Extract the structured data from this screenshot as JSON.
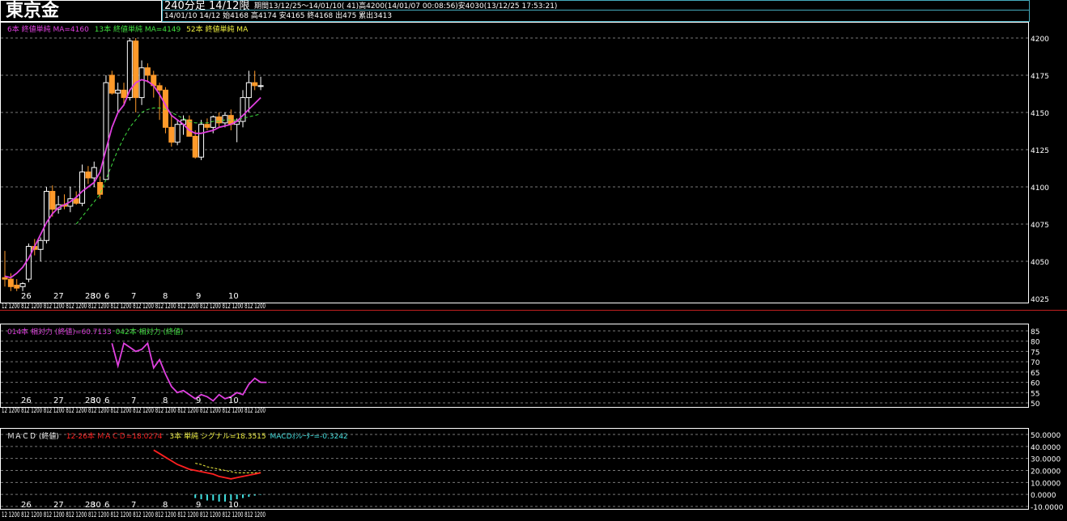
{
  "header": {
    "title": "東京金",
    "timeframe": "240分足 14/12限",
    "period": "期間13/12/25～14/01/10( 41)高4200(14/01/07 00:08:56)安4030(13/12/25 17:53:21)",
    "last_bar": "14/01/10 14/12 始4168 高4174 安4165 終4168 出475 累出3413"
  },
  "main_panel": {
    "legend": [
      {
        "text": "6本 終値単純 MA=4160",
        "color": "#e040e0"
      },
      {
        "text": "13本 終値単純 MA=4149",
        "color": "#40e040"
      },
      {
        "text": "52本 終値単純 MA",
        "color": "#f0f040"
      }
    ],
    "y_ticks": [
      "4200",
      "4175",
      "4150",
      "4125",
      "4100",
      "4075",
      "4050",
      "4025"
    ],
    "date_labels": [
      "26",
      "27",
      "28",
      "30",
      "6",
      "7",
      "8",
      "9",
      "10"
    ],
    "time_labels": "12 1200 812 1200 812 1200 812 1200 812 1200 812 1200 812 1200 812 1200 812 1200 812 1200 812 1200 812 1200"
  },
  "rsi_panel": {
    "legend": [
      {
        "text": "014本 相対力 (終値)=60.7133",
        "color": "#e040e0"
      },
      {
        "text": "042本 相対力 (終値)",
        "color": "#40e040"
      }
    ],
    "y_ticks": [
      "85",
      "80",
      "75",
      "70",
      "65",
      "60",
      "55",
      "50"
    ],
    "date_labels": [
      "26",
      "27",
      "28",
      "30",
      "6",
      "7",
      "8",
      "9",
      "10"
    ]
  },
  "macd_panel": {
    "legend": [
      {
        "text": "ＭＡＣＤ (終値)",
        "color": "#ffffff"
      },
      {
        "text": "12-26本 ＭＡＣＤ=18.0274",
        "color": "#ff2020"
      },
      {
        "text": "3本 単純 シグナル=18.3515",
        "color": "#f0f040"
      },
      {
        "text": "MACDｵｼﾚｰﾀｰ=-0.3242",
        "color": "#40e0e0"
      }
    ],
    "y_ticks": [
      "50.0000",
      "40.0000",
      "30.0000",
      "20.0000",
      "10.0000",
      "0.0000",
      "-10.0000"
    ],
    "date_labels": [
      "26",
      "27",
      "28",
      "30",
      "6",
      "7",
      "8",
      "9",
      "10"
    ]
  },
  "chart_data": [
    {
      "type": "candlestick",
      "title": "東京金",
      "ylim": [
        4025,
        4200
      ],
      "candles": [
        {
          "o": 4039,
          "h": 4057,
          "l": 4033,
          "c": 4038
        },
        {
          "o": 4038,
          "h": 4042,
          "l": 4030,
          "c": 4033
        },
        {
          "o": 4034,
          "h": 4038,
          "l": 4030,
          "c": 4032
        },
        {
          "o": 4033,
          "h": 4036,
          "l": 4030,
          "c": 4035
        },
        {
          "o": 4038,
          "h": 4062,
          "l": 4036,
          "c": 4060
        },
        {
          "o": 4060,
          "h": 4065,
          "l": 4054,
          "c": 4058
        },
        {
          "o": 4058,
          "h": 4066,
          "l": 4050,
          "c": 4064
        },
        {
          "o": 4064,
          "h": 4100,
          "l": 4062,
          "c": 4097
        },
        {
          "o": 4097,
          "h": 4101,
          "l": 4080,
          "c": 4085
        },
        {
          "o": 4085,
          "h": 4094,
          "l": 4082,
          "c": 4088
        },
        {
          "o": 4088,
          "h": 4095,
          "l": 4085,
          "c": 4087
        },
        {
          "o": 4087,
          "h": 4100,
          "l": 4083,
          "c": 4092
        },
        {
          "o": 4092,
          "h": 4097,
          "l": 4088,
          "c": 4089
        },
        {
          "o": 4089,
          "h": 4115,
          "l": 4087,
          "c": 4110
        },
        {
          "o": 4110,
          "h": 4114,
          "l": 4102,
          "c": 4106
        },
        {
          "o": 4106,
          "h": 4117,
          "l": 4100,
          "c": 4113
        },
        {
          "o": 4103,
          "h": 4107,
          "l": 4092,
          "c": 4095
        },
        {
          "o": 4105,
          "h": 4175,
          "l": 4150,
          "c": 4170
        },
        {
          "o": 4175,
          "h": 4178,
          "l": 4162,
          "c": 4163
        },
        {
          "o": 4163,
          "h": 4170,
          "l": 4150,
          "c": 4165
        },
        {
          "o": 4165,
          "h": 4170,
          "l": 4155,
          "c": 4160
        },
        {
          "o": 4160,
          "h": 4200,
          "l": 4158,
          "c": 4198
        },
        {
          "o": 4198,
          "h": 4200,
          "l": 4150,
          "c": 4160
        },
        {
          "o": 4160,
          "h": 4185,
          "l": 4155,
          "c": 4180
        },
        {
          "o": 4180,
          "h": 4183,
          "l": 4170,
          "c": 4175
        },
        {
          "o": 4175,
          "h": 4178,
          "l": 4160,
          "c": 4168
        },
        {
          "o": 4168,
          "h": 4170,
          "l": 4145,
          "c": 4165
        },
        {
          "o": 4165,
          "h": 4167,
          "l": 4136,
          "c": 4140
        },
        {
          "o": 4140,
          "h": 4148,
          "l": 4127,
          "c": 4130
        },
        {
          "o": 4130,
          "h": 4145,
          "l": 4128,
          "c": 4142
        },
        {
          "o": 4142,
          "h": 4148,
          "l": 4135,
          "c": 4145
        },
        {
          "o": 4145,
          "h": 4148,
          "l": 4138,
          "c": 4134
        },
        {
          "o": 4134,
          "h": 4138,
          "l": 4119,
          "c": 4120
        },
        {
          "o": 4120,
          "h": 4145,
          "l": 4118,
          "c": 4142
        },
        {
          "o": 4142,
          "h": 4146,
          "l": 4138,
          "c": 4140
        },
        {
          "o": 4140,
          "h": 4148,
          "l": 4136,
          "c": 4147
        },
        {
          "o": 4147,
          "h": 4150,
          "l": 4140,
          "c": 4143
        },
        {
          "o": 4143,
          "h": 4150,
          "l": 4140,
          "c": 4148
        },
        {
          "o": 4148,
          "h": 4152,
          "l": 4138,
          "c": 4142
        },
        {
          "o": 4142,
          "h": 4146,
          "l": 4130,
          "c": 4144
        },
        {
          "o": 4144,
          "h": 4165,
          "l": 4140,
          "c": 4160
        },
        {
          "o": 4160,
          "h": 4178,
          "l": 4150,
          "c": 4170
        },
        {
          "o": 4170,
          "h": 4178,
          "l": 4165,
          "c": 4168
        },
        {
          "o": 4168,
          "h": 4174,
          "l": 4165,
          "c": 4168
        }
      ],
      "ma6": [
        4040,
        4039,
        4042,
        4046,
        4052,
        4060,
        4068,
        4076,
        4082,
        4086,
        4088,
        4090,
        4093,
        4097,
        4100,
        4103,
        4110,
        4125,
        4140,
        4150,
        4155,
        4165,
        4170,
        4172,
        4171,
        4168,
        4162,
        4155,
        4148,
        4145,
        4142,
        4138,
        4136,
        4136,
        4137,
        4138,
        4140,
        4141,
        4142,
        4144,
        4148,
        4152,
        4156,
        4160
      ],
      "ma13": [
        null,
        null,
        null,
        null,
        null,
        null,
        null,
        null,
        null,
        null,
        null,
        null,
        4075,
        4080,
        4085,
        4090,
        4095,
        4105,
        4115,
        4125,
        4133,
        4140,
        4145,
        4150,
        4152,
        4153,
        4153,
        4152,
        4150,
        4148,
        4146,
        4144,
        4143,
        4143,
        4143,
        4144,
        4144,
        4145,
        4145,
        4145,
        4146,
        4147,
        4148,
        4149
      ]
    },
    {
      "type": "line",
      "title": "014本 相対力 (終値)",
      "ylim": [
        50,
        85
      ],
      "values": [
        null,
        null,
        null,
        null,
        null,
        null,
        null,
        null,
        null,
        null,
        null,
        null,
        null,
        null,
        null,
        null,
        null,
        null,
        79,
        68,
        79,
        77,
        75,
        76,
        79,
        67,
        71,
        64,
        58,
        55,
        56,
        54,
        52,
        54,
        53,
        51,
        54,
        52,
        53,
        55,
        54,
        59,
        62,
        60,
        60
      ]
    },
    {
      "type": "line",
      "title": "ＭＡＣＤ (終値)",
      "ylim": [
        -10,
        50
      ],
      "macd": [
        null,
        null,
        null,
        null,
        null,
        null,
        null,
        null,
        null,
        null,
        null,
        null,
        null,
        null,
        null,
        null,
        null,
        null,
        null,
        null,
        null,
        null,
        null,
        null,
        null,
        37,
        34,
        31,
        28,
        25,
        23,
        21,
        20,
        19,
        18,
        17,
        15,
        14,
        13,
        14,
        15,
        16,
        17,
        18.03
      ],
      "signal": [
        null,
        null,
        null,
        null,
        null,
        null,
        null,
        null,
        null,
        null,
        null,
        null,
        null,
        null,
        null,
        null,
        null,
        null,
        null,
        null,
        null,
        null,
        null,
        null,
        null,
        null,
        null,
        null,
        null,
        null,
        null,
        null,
        26,
        25,
        23,
        22,
        21,
        20,
        19,
        18,
        18,
        18,
        18,
        18.35
      ],
      "oscillator": [
        null,
        null,
        null,
        null,
        null,
        null,
        null,
        null,
        null,
        null,
        null,
        null,
        null,
        null,
        null,
        null,
        null,
        null,
        null,
        null,
        null,
        null,
        null,
        null,
        null,
        null,
        null,
        null,
        null,
        null,
        null,
        null,
        -3,
        -4,
        -5,
        -5,
        -6,
        -6,
        -5,
        -4,
        -3,
        -2,
        -1,
        -0.32
      ]
    }
  ]
}
